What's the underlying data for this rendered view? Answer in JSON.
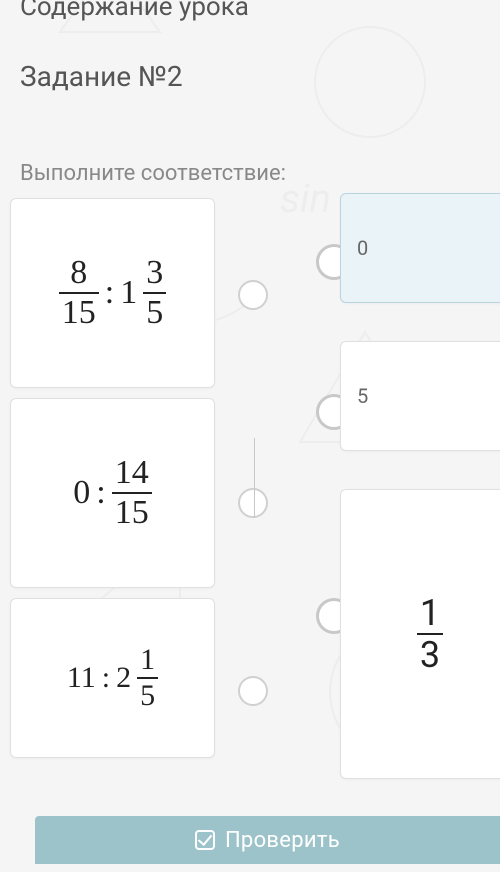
{
  "topText": "Содержание урока",
  "title": "Задание №2",
  "instruction": "Выполните соответствие:",
  "left": [
    {
      "type": "frac_div_mixed",
      "a_num": "8",
      "a_den": "15",
      "op": ":",
      "b_whole": "1",
      "b_num": "3",
      "b_den": "5"
    },
    {
      "type": "int_div_frac",
      "a": "0",
      "op": ":",
      "b_num": "14",
      "b_den": "15"
    },
    {
      "type": "int_div_mixed",
      "a": "11",
      "op": ":",
      "b_whole": "2",
      "b_num": "1",
      "b_den": "5"
    }
  ],
  "right": [
    {
      "display": "text",
      "value": "0",
      "selected": true
    },
    {
      "display": "text",
      "value": "5",
      "selected": false
    },
    {
      "display": "frac",
      "num": "1",
      "den": "3",
      "selected": false
    }
  ],
  "checkButton": "Проверить"
}
